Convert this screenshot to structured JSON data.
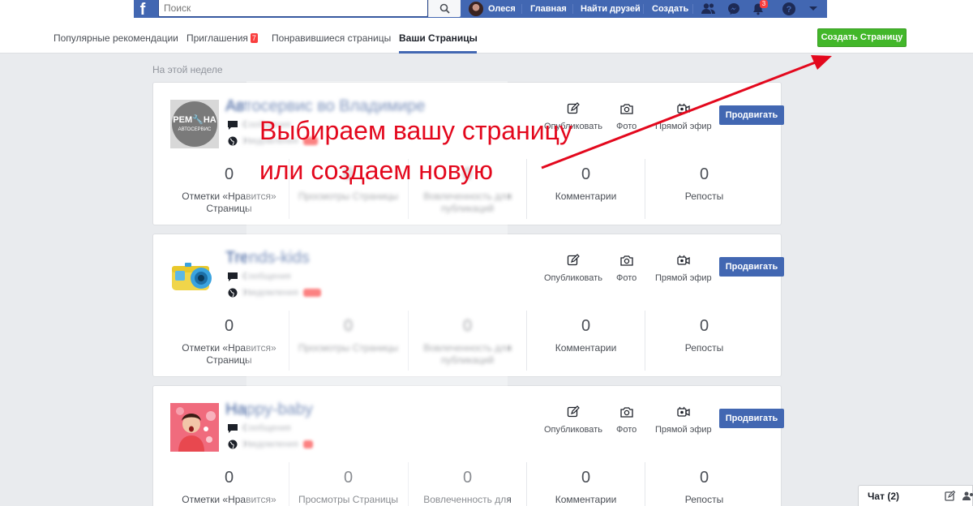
{
  "topbar": {
    "logo": "f",
    "search_placeholder": "Поиск",
    "user_name": "Олеся",
    "nav": {
      "home": "Главная",
      "find_friends": "Найти друзей",
      "create": "Создать"
    },
    "notifications_count": "3"
  },
  "subnav": {
    "items": [
      {
        "label": "Популярные рекомендации"
      },
      {
        "label": "Приглашения",
        "badge": "7"
      },
      {
        "label": "Понравившиеся страницы"
      },
      {
        "label": "Ваши Страницы"
      }
    ],
    "create_page_button": "Создать Страницу"
  },
  "week_label": "На этой неделе",
  "actions": {
    "publish": "Опубликовать",
    "photo": "Фото",
    "live": "Прямой эфир"
  },
  "promote_label": "Продвигать",
  "pages": [
    {
      "name_visible": "Авт",
      "name_hidden": "осервис во Владимире",
      "thumb_text_top": "РЕМ🔧НА",
      "thumb_text_bottom": "АВТОСЕРВИС",
      "meta_1": "Сообщения",
      "meta_2": "Уведомления",
      "stats": [
        {
          "value": "0",
          "label": "Отметки «Нравится» Страницы"
        },
        {
          "value": "0",
          "label": "Просмотры Страницы"
        },
        {
          "value": "0",
          "label": "Вовлеченность для публикаций"
        },
        {
          "value": "0",
          "label": "Комментарии"
        },
        {
          "value": "0",
          "label": "Репосты"
        }
      ]
    },
    {
      "name_visible": "Tre",
      "name_hidden": "nds-kids",
      "meta_1": "Сообщения",
      "meta_2": "Уведомления",
      "stats": [
        {
          "value": "0",
          "label": "Отметки «Нравится» Страницы"
        },
        {
          "value": "0",
          "label": "Просмотры Страницы"
        },
        {
          "value": "0",
          "label": "Вовлеченность для публикаций"
        },
        {
          "value": "0",
          "label": "Комментарии"
        },
        {
          "value": "0",
          "label": "Репосты"
        }
      ]
    },
    {
      "name_visible": "Ha",
      "name_hidden": "ppy-baby",
      "meta_1": "Сообщения",
      "meta_2": "Уведомления",
      "stats": [
        {
          "value": "0",
          "label": "Отметки «Нравится» Страницы"
        },
        {
          "value": "0",
          "label": "Просмотры Страницы"
        },
        {
          "value": "0",
          "label": "Вовлеченность для публикаций"
        },
        {
          "value": "0",
          "label": "Комментарии"
        },
        {
          "value": "0",
          "label": "Репосты"
        }
      ]
    }
  ],
  "annotation": {
    "line_1": "Выбираем вашу страницу",
    "line_2": "или создаем новую",
    "color": "#e3081d"
  },
  "chat": {
    "label": "Чат (2)"
  },
  "colors": {
    "brand_blue": "#4267b2",
    "green": "#42b72a",
    "red": "#fa3e3e"
  }
}
